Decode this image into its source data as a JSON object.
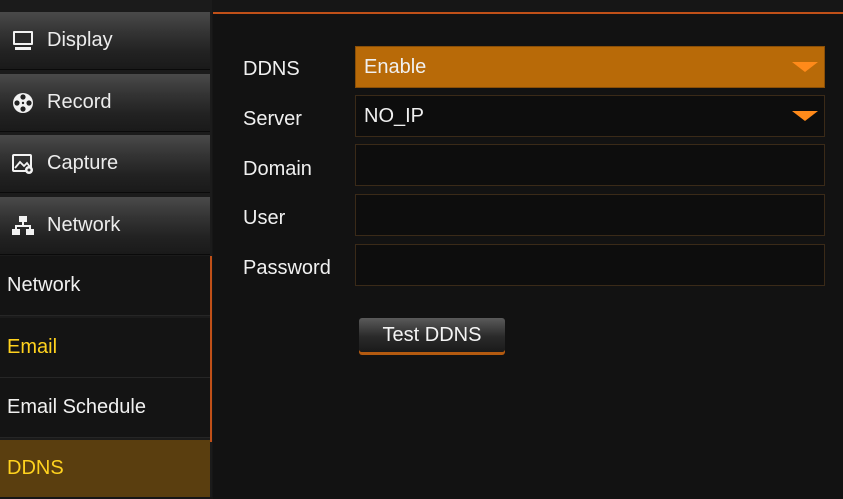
{
  "sidebar": {
    "menu": [
      {
        "label": "Display",
        "icon": "monitor-icon"
      },
      {
        "label": "Record",
        "icon": "film-reel-icon"
      },
      {
        "label": "Capture",
        "icon": "image-capture-icon"
      },
      {
        "label": "Network",
        "icon": "network-icon"
      }
    ],
    "sub_items": [
      {
        "label": "Network",
        "state": "normal"
      },
      {
        "label": "Email",
        "state": "highlighted"
      },
      {
        "label": "Email Schedule",
        "state": "normal"
      },
      {
        "label": "DDNS",
        "state": "selected"
      }
    ]
  },
  "form": {
    "ddns": {
      "label": "DDNS",
      "value": "Enable"
    },
    "server": {
      "label": "Server",
      "value": "NO_IP"
    },
    "domain": {
      "label": "Domain",
      "value": ""
    },
    "user": {
      "label": "User",
      "value": ""
    },
    "password": {
      "label": "Password",
      "value": ""
    },
    "test_button": "Test DDNS"
  },
  "colors": {
    "accent": "#c05018",
    "highlight_text": "#ffd21e",
    "dropdown_fill": "#b86a08",
    "arrow": "#ff8a1a"
  }
}
